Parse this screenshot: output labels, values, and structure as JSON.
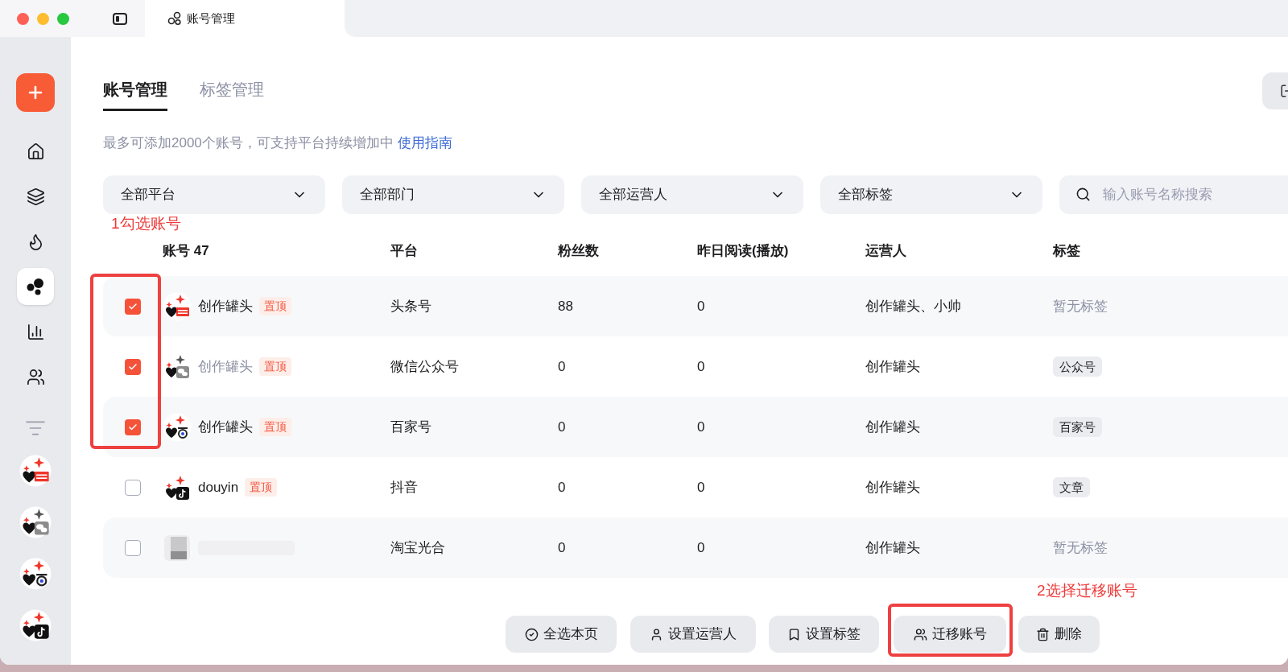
{
  "window": {
    "tab_title": "账号管理"
  },
  "page_tabs": [
    {
      "label": "账号管理",
      "selected": true
    },
    {
      "label": "标签管理",
      "selected": false
    }
  ],
  "notice": {
    "text": "最多可添加2000个账号，可支持平台持续增加中",
    "link": "使用指南"
  },
  "filters": [
    {
      "label": "全部平台"
    },
    {
      "label": "全部部门"
    },
    {
      "label": "全部运营人"
    },
    {
      "label": "全部标签"
    }
  ],
  "search": {
    "placeholder": "输入账号名称搜索"
  },
  "sidebar": {
    "items": [
      {
        "kind": "home",
        "selected": false
      },
      {
        "kind": "layers",
        "selected": false
      },
      {
        "kind": "flame",
        "selected": false
      },
      {
        "kind": "circles",
        "selected": true
      },
      {
        "kind": "chart",
        "selected": false
      },
      {
        "kind": "users",
        "selected": false
      }
    ],
    "accounts": [
      {
        "kind": "toutiao"
      },
      {
        "kind": "wechat"
      },
      {
        "kind": "baijia"
      },
      {
        "kind": "douyin"
      }
    ]
  },
  "table": {
    "columns": [
      "账号 47",
      "平台",
      "粉丝数",
      "昨日阅读(播放)",
      "运营人",
      "标签"
    ],
    "rows": [
      {
        "checked": true,
        "kind": "toutiao",
        "name": "创作罐头",
        "dimmed": false,
        "badge": "置顶",
        "platform": "头条号",
        "fans": "88",
        "reads": "0",
        "operator": "创作罐头、小帅",
        "tag": {
          "kind": "empty",
          "text": "暂无标签"
        }
      },
      {
        "checked": true,
        "kind": "wechat",
        "name": "创作罐头",
        "dimmed": true,
        "badge": "置顶",
        "platform": "微信公众号",
        "fans": "0",
        "reads": "0",
        "operator": "创作罐头",
        "tag": {
          "kind": "chip",
          "text": "公众号"
        }
      },
      {
        "checked": true,
        "kind": "baijia",
        "name": "创作罐头",
        "dimmed": false,
        "badge": "置顶",
        "platform": "百家号",
        "fans": "0",
        "reads": "0",
        "operator": "创作罐头",
        "tag": {
          "kind": "chip",
          "text": "百家号"
        }
      },
      {
        "checked": false,
        "kind": "douyin",
        "name": "douyin",
        "dimmed": false,
        "badge": "置顶",
        "platform": "抖音",
        "fans": "0",
        "reads": "0",
        "operator": "创作罐头",
        "tag": {
          "kind": "chip",
          "text": "文章"
        }
      },
      {
        "checked": false,
        "kind": "blurred",
        "platform": "淘宝光合",
        "fans": "0",
        "reads": "0",
        "operator": "创作罐头",
        "tag": {
          "kind": "empty",
          "text": "暂无标签"
        }
      }
    ]
  },
  "actions": [
    {
      "label": "全选本页"
    },
    {
      "label": "设置运营人"
    },
    {
      "label": "设置标签"
    },
    {
      "label": "迁移账号"
    },
    {
      "label": "删除"
    }
  ],
  "annotations": [
    "1勾选账号",
    "2选择迁移账号"
  ]
}
